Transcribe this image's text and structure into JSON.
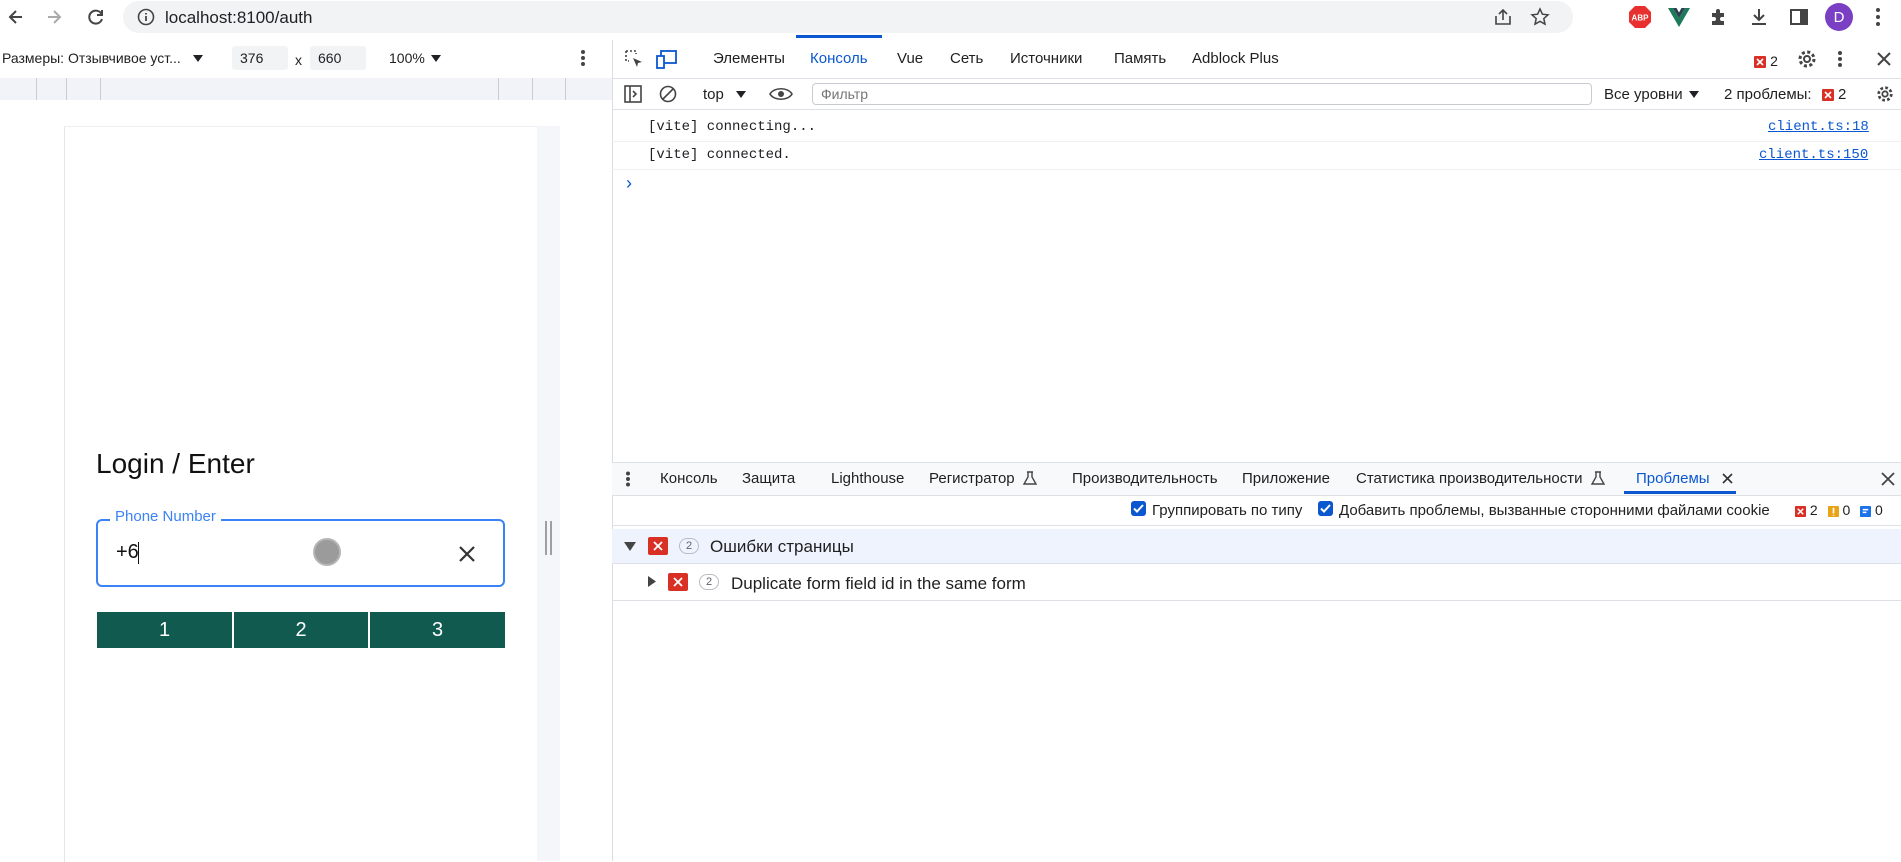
{
  "browser": {
    "url": "localhost:8100/auth",
    "profile_initial": "D",
    "extension_abp": "ABP"
  },
  "device_toolbar": {
    "device_label": "Размеры: Отзывчивое уст...",
    "width": "376",
    "times": "x",
    "height": "660",
    "zoom": "100%"
  },
  "app": {
    "title": "Login / Enter",
    "phone_label": "Phone Number",
    "phone_value": "+6",
    "keys": [
      "1",
      "2",
      "3"
    ]
  },
  "devtools": {
    "tabs": [
      "Элементы",
      "Консоль",
      "Vue",
      "Сеть",
      "Источники",
      "Память",
      "Adblock Plus"
    ],
    "active_tab": "Консоль",
    "error_count": "2",
    "context": "top",
    "filter_placeholder": "Фильтр",
    "levels": "Все уровни",
    "problems_label": "2 проблемы:",
    "problems_count": "2",
    "console_lines": [
      {
        "message": "[vite] connecting...",
        "source": "client.ts:18"
      },
      {
        "message": "[vite] connected.",
        "source": "client.ts:150"
      }
    ],
    "prompt": "›",
    "drawer_tabs": [
      "Консоль",
      "Защита",
      "Lighthouse",
      "Регистратор",
      "Производительность",
      "Приложение",
      "Статистика производительности",
      "Проблемы"
    ],
    "active_drawer_tab": "Проблемы",
    "group_by_type": "Группировать по типу",
    "third_party": "Добавить проблемы, вызванные сторонними файлами cookie",
    "issue_counts": {
      "errors": "2",
      "warnings": "0",
      "info": "0"
    },
    "issue_group": {
      "title": "Ошибки страницы",
      "count": "2"
    },
    "issue": {
      "title": "Duplicate form field id in the same form",
      "count": "2"
    }
  },
  "colors": {
    "accent": "#0b57d0",
    "key_bg": "#115a50",
    "field_border": "#3b82f6",
    "error": "#d93025"
  }
}
